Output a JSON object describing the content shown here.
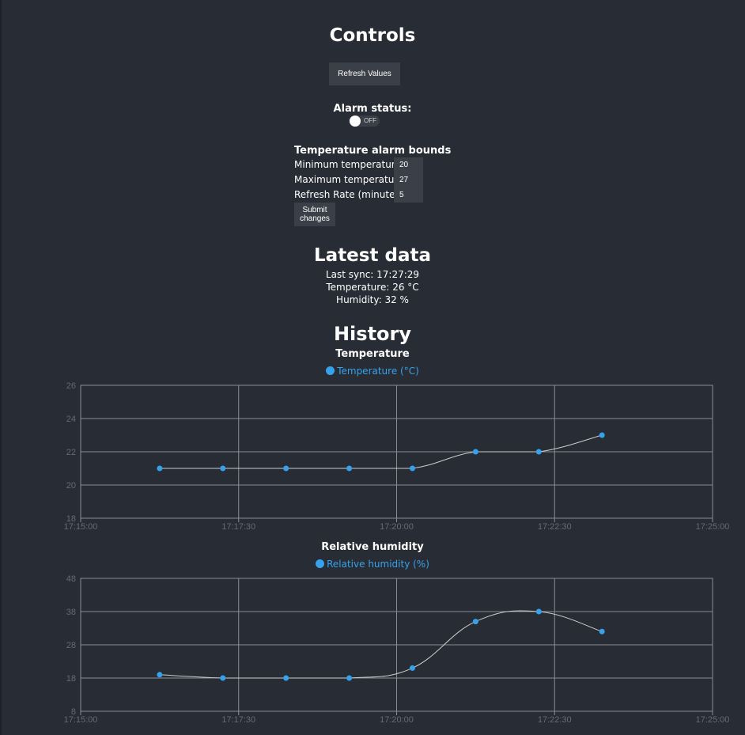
{
  "controls": {
    "title": "Controls",
    "refresh_label": "Refresh Values",
    "alarm_label": "Alarm status:",
    "alarm_state": "OFF"
  },
  "bounds": {
    "title": "Temperature alarm bounds",
    "min_label": "Minimum temperature:",
    "min_value": "20",
    "max_label": "Maximum temperature:",
    "max_value": "27",
    "rate_label": "Refresh Rate (minutes):",
    "rate_value": "5",
    "submit_label": "Submit changes"
  },
  "latest": {
    "title": "Latest data",
    "sync": "Last sync: 17:27:29",
    "temperature": "Temperature: 26 °C",
    "humidity": "Humidity: 32 %"
  },
  "history": {
    "title": "History"
  },
  "colors": {
    "background": "#282c34",
    "series": "#36a2eb",
    "grid": "#8a8d94",
    "line": "#cccccc"
  },
  "chart_data": [
    {
      "type": "line",
      "title": "Temperature",
      "series": [
        {
          "name": "Temperature (°C)",
          "x": [
            "17:16:15",
            "17:17:15",
            "17:18:15",
            "17:19:15",
            "17:20:15",
            "17:21:15",
            "17:22:15",
            "17:23:15"
          ],
          "values": [
            21,
            21,
            21,
            21,
            21,
            22,
            22,
            23
          ]
        }
      ],
      "xlim": [
        "17:15:00",
        "17:25:00"
      ],
      "xticks": [
        "17:15:00",
        "17:17:30",
        "17:20:00",
        "17:22:30",
        "17:25:00"
      ],
      "ylim": [
        18,
        26
      ],
      "yticks": [
        18,
        20,
        22,
        24,
        26
      ],
      "grid": true,
      "legend": "top-center"
    },
    {
      "type": "line",
      "title": "Relative humidity",
      "series": [
        {
          "name": "Relative humidity (%)",
          "x": [
            "17:16:15",
            "17:17:15",
            "17:18:15",
            "17:19:15",
            "17:20:15",
            "17:21:15",
            "17:22:15",
            "17:23:15"
          ],
          "values": [
            19,
            18,
            18,
            18,
            21,
            35,
            38,
            32
          ]
        }
      ],
      "xlim": [
        "17:15:00",
        "17:25:00"
      ],
      "xticks": [
        "17:15:00",
        "17:17:30",
        "17:20:00",
        "17:22:30",
        "17:25:00"
      ],
      "ylim": [
        8,
        48
      ],
      "yticks": [
        8,
        18,
        28,
        38,
        48
      ],
      "grid": true,
      "legend": "top-center"
    }
  ]
}
